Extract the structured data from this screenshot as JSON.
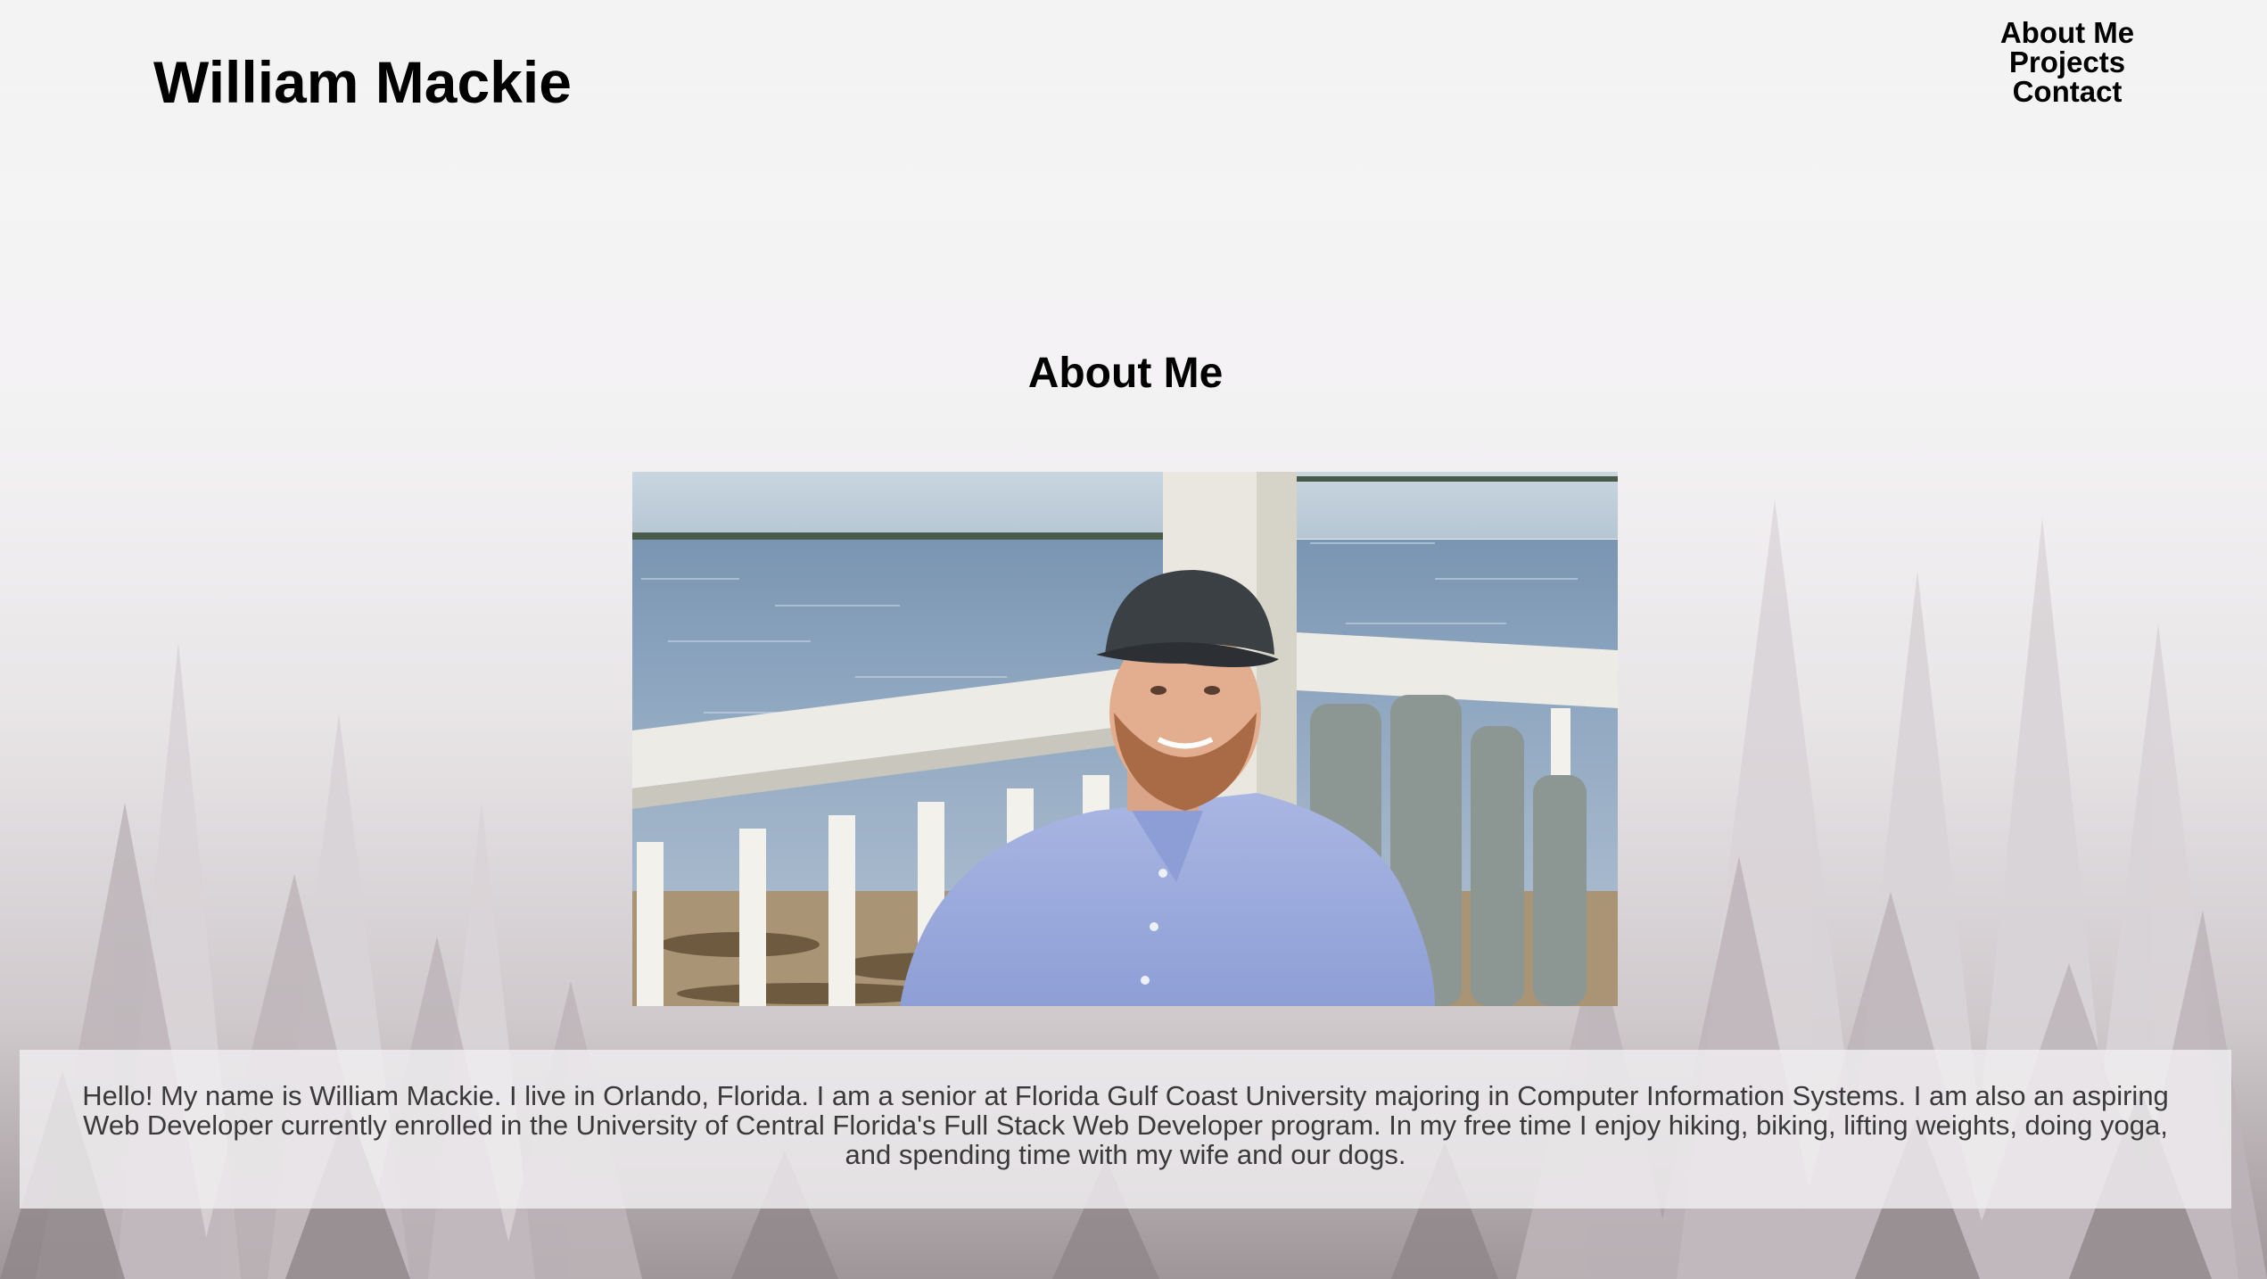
{
  "header": {
    "site_title": "William Mackie",
    "nav": [
      {
        "label": "About Me"
      },
      {
        "label": "Projects"
      },
      {
        "label": "Contact"
      }
    ]
  },
  "about": {
    "heading": "About Me",
    "photo_icon": "profile-photo",
    "bio": "Hello! My name is William Mackie. I live in Orlando, Florida. I am a senior at Florida Gulf Coast University majoring in Computer Information Systems. I am also an aspiring Web Developer currently enrolled in the University of Central Florida's Full Stack Web Developer program. In my free time I enjoy hiking, biking, lifting weights, doing yoga, and spending time with my wife and our dogs."
  },
  "colors": {
    "text": "#000000",
    "bio_text": "#3a3a3a",
    "bio_box": "#f0eef0"
  }
}
